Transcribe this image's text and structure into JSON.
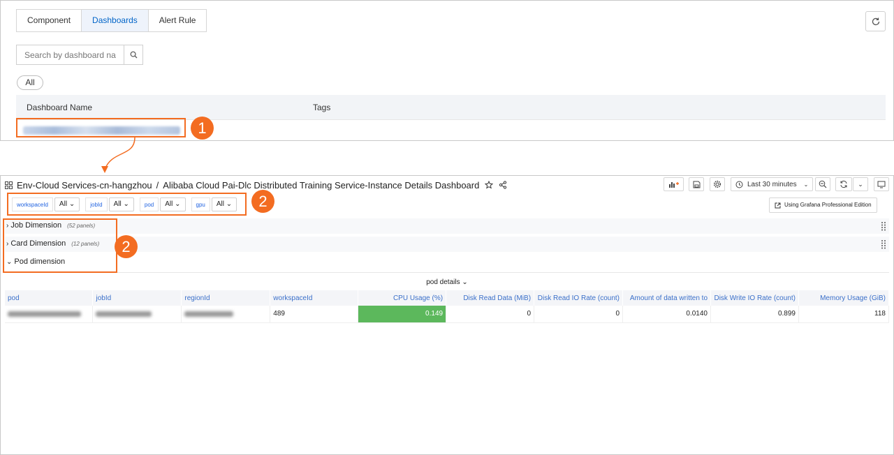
{
  "top": {
    "tabs": [
      {
        "label": "Component",
        "active": false
      },
      {
        "label": "Dashboards",
        "active": true
      },
      {
        "label": "Alert Rule",
        "active": false
      }
    ],
    "search_placeholder": "Search by dashboard name",
    "tag_filter": "All",
    "table": {
      "headers": [
        "Dashboard Name",
        "Tags"
      ]
    }
  },
  "callouts": {
    "one": "1",
    "two_a": "2",
    "two_b": "2",
    "color": "#f36c21"
  },
  "grafana": {
    "breadcrumb_folder": "Env-Cloud Services-cn-hangzhou",
    "breadcrumb_sep": "/",
    "dashboard_title": "Alibaba Cloud Pai-Dlc Distributed Training Service-Instance Details Dashboard",
    "time_range": "Last 30 minutes",
    "pro_button": "Using Grafana Professional Edition",
    "variables": [
      {
        "label": "workspaceId",
        "value": "All"
      },
      {
        "label": "jobId",
        "value": "All"
      },
      {
        "label": "pod",
        "value": "All"
      },
      {
        "label": "gpu",
        "value": "All"
      }
    ],
    "rows": [
      {
        "title": "Job Dimension",
        "count": "(52 panels)",
        "collapsed": true
      },
      {
        "title": "Card Dimension",
        "count": "(12 panels)",
        "collapsed": true
      },
      {
        "title": "Pod dimension",
        "count": "",
        "collapsed": false
      }
    ],
    "pod_panel": {
      "title": "pod details",
      "columns": [
        "pod",
        "jobId",
        "regionId",
        "workspaceId",
        "CPU Usage (%)",
        "Disk Read Data (MiB)",
        "Disk Read IO Rate (count)",
        "Amount of data written to",
        "Disk Write IO Rate (count)",
        "Memory Usage (GiB)"
      ],
      "row": {
        "workspaceId": "489",
        "cpu": "0.149",
        "disk_read": "0",
        "disk_read_io": "0",
        "written": "0.0140",
        "disk_write_io": "0.899",
        "memory": "118"
      },
      "cpu_color": "#5cb85c"
    }
  }
}
